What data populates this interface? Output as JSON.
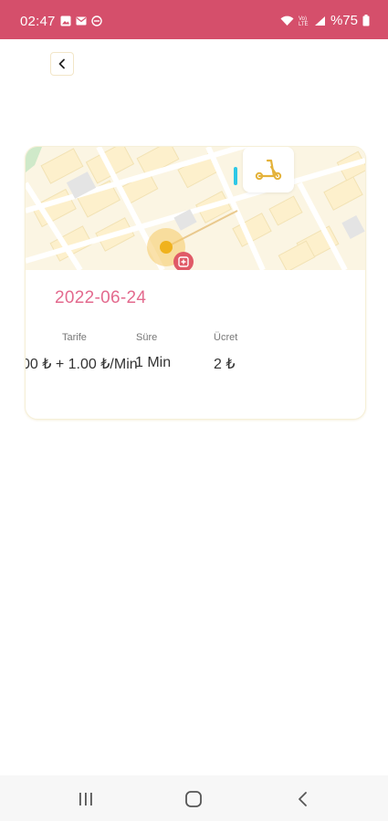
{
  "status_bar": {
    "time": "02:47",
    "battery": "%75",
    "icons": [
      "image-icon",
      "mail-icon",
      "do-not-disturb-icon",
      "wifi-icon",
      "volte-icon",
      "signal-icon",
      "battery-icon"
    ],
    "color": "#d54f6b"
  },
  "header": {
    "back_icon": "chevron-left-icon"
  },
  "trip": {
    "date": "2022-06-24",
    "vehicle_icon": "scooter-icon",
    "columns": [
      {
        "label": "Tarife",
        "value": "00 ₺ + 1.00 ₺/Min"
      },
      {
        "label": "Süre",
        "value": "1 Min"
      },
      {
        "label": "Ücret",
        "value": "2 ₺"
      }
    ]
  },
  "colors": {
    "accent": "#e36a8e",
    "scooter": "#e4b23a",
    "marker": "#f0b21d"
  },
  "nav_bar": {
    "buttons": [
      "recent-apps-icon",
      "home-icon",
      "back-icon"
    ]
  }
}
